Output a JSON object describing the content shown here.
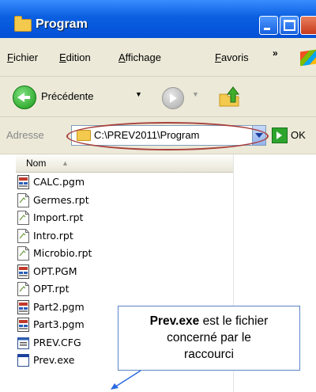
{
  "window": {
    "title": "Program"
  },
  "menu": {
    "items": [
      "Fichier",
      "Edition",
      "Affichage",
      "Favoris"
    ],
    "overflow": "»"
  },
  "toolbar": {
    "back_label": "Précédente",
    "dropdown_glyph": "▼"
  },
  "address": {
    "label": "Adresse",
    "value": "C:\\PREV2011\\Program",
    "go_label": "OK"
  },
  "list": {
    "column_header": "Nom",
    "sort_glyph": "▲",
    "files": [
      {
        "name": "CALC.pgm",
        "icon": "program-icon"
      },
      {
        "name": "Germes.rpt",
        "icon": "report-icon"
      },
      {
        "name": "Import.rpt",
        "icon": "report-icon"
      },
      {
        "name": "Intro.rpt",
        "icon": "report-icon"
      },
      {
        "name": "Microbio.rpt",
        "icon": "report-icon"
      },
      {
        "name": "OPT.PGM",
        "icon": "program-icon"
      },
      {
        "name": "OPT.rpt",
        "icon": "report-icon"
      },
      {
        "name": "Part2.pgm",
        "icon": "program-icon"
      },
      {
        "name": "Part3.pgm",
        "icon": "program-icon"
      },
      {
        "name": "PREV.CFG",
        "icon": "config-icon"
      },
      {
        "name": "Prev.exe",
        "icon": "exe-icon"
      }
    ]
  },
  "callout": {
    "bold": "Prev.exe",
    "line1_rest": " est le fichier",
    "line2": "concerné par le",
    "line3": "raccourci"
  },
  "colors": {
    "titlebar": "#0a5fe0",
    "highlight": "#a8413d",
    "callout_border": "#5c84c9",
    "arrow": "#2b6be0"
  }
}
